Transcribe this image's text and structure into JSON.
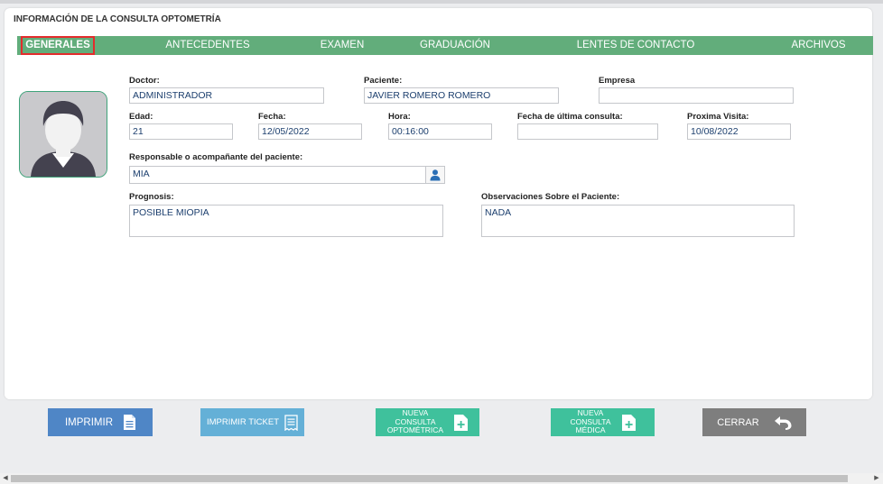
{
  "card": {
    "title": "INFORMACIÓN DE LA CONSULTA OPTOMETRÍA"
  },
  "tabs": [
    {
      "label": "GENERALES",
      "active": true
    },
    {
      "label": "ANTECEDENTES"
    },
    {
      "label": "EXAMEN"
    },
    {
      "label": "GRADUACIÓN"
    },
    {
      "label": "LENTES DE CONTACTO"
    },
    {
      "label": "ARCHIVOS"
    }
  ],
  "form": {
    "doctor": {
      "label": "Doctor:",
      "value": "ADMINISTRADOR"
    },
    "paciente": {
      "label": "Paciente:",
      "value": "JAVIER ROMERO ROMERO"
    },
    "empresa": {
      "label": "Empresa",
      "value": ""
    },
    "edad": {
      "label": "Edad:",
      "value": "21"
    },
    "fecha": {
      "label": "Fecha:",
      "value": "12/05/2022"
    },
    "hora": {
      "label": "Hora:",
      "value": "00:16:00"
    },
    "ultima": {
      "label": "Fecha de última consulta:",
      "value": ""
    },
    "proxima": {
      "label": "Proxima Visita:",
      "value": "10/08/2022"
    },
    "responsable": {
      "label": "Responsable o acompañante del paciente:",
      "value": "MIA"
    },
    "prognosis": {
      "label": "Prognosis:",
      "value": "POSIBLE MIOPIA"
    },
    "observaciones": {
      "label": "Observaciones Sobre el Paciente:",
      "value": "NADA"
    }
  },
  "buttons": {
    "imprimir": "IMPRIMIR",
    "ticket": "IMPRIMIR TICKET",
    "nueva_opto": [
      "NUEVA",
      "CONSULTA",
      "OPTOMÉTRICA"
    ],
    "nueva_medica": [
      "NUEVA",
      "CONSULTA",
      "MÉDICA"
    ],
    "cerrar": "CERRAR"
  },
  "colors": {
    "tab_bar": "#62ad7b",
    "active_tab_border": "#e32c2c",
    "btn_imprimir": "#4f86c6",
    "btn_ticket": "#64b0d7",
    "btn_nueva": "#3fc19c",
    "btn_cerrar": "#7e7e7e",
    "input_text": "#1c3f6e"
  },
  "icons": {
    "avatar": "user-avatar-icon",
    "person": "person-icon",
    "document": "document-icon",
    "receipt": "receipt-icon",
    "add_file": "file-add-icon",
    "return": "return-arrow-icon"
  }
}
